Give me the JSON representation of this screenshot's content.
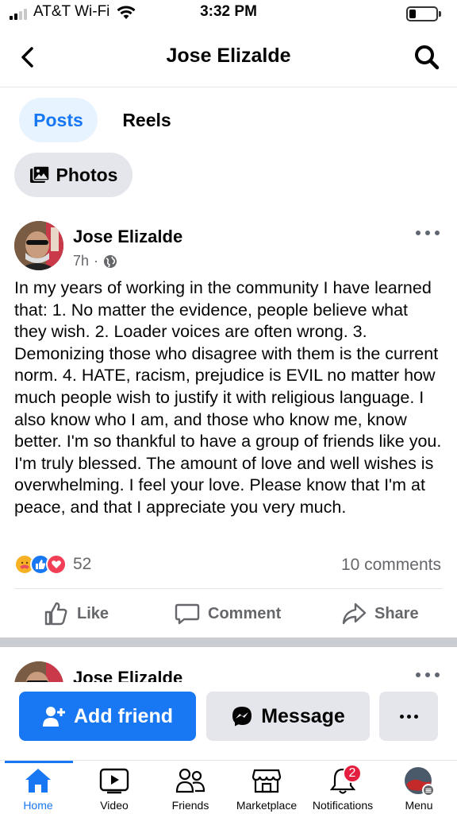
{
  "status_bar": {
    "carrier": "AT&T Wi-Fi",
    "time": "3:32 PM",
    "battery_level": 0.25
  },
  "header": {
    "title": "Jose Elizalde",
    "back_icon": "chevron-left-icon",
    "search_icon": "search-icon"
  },
  "tabs": {
    "posts": "Posts",
    "reels": "Reels",
    "photos": "Photos",
    "active": "Posts"
  },
  "post": {
    "author": "Jose Elizalde",
    "time": "7h",
    "audience": "·",
    "audience_icon": "globe-icon",
    "text": "In my years of working in the community I have learned that: 1. No matter the evidence, people believe what they wish. 2. Loader voices are often wrong. 3. Demonizing those who disagree with them is the current norm. 4. HATE, racism, prejudice is EVIL no matter how much people wish to justify it with religious language. I also know who I am, and those who know me, know better. I'm so thankful to have a group of friends like you. I'm truly blessed. The amount of love and well wishes is overwhelming. I feel your love. Please know that I'm at peace, and that I appreciate you very much.",
    "reaction_count": "52",
    "reaction_icons": [
      "care-icon",
      "like-icon",
      "love-icon"
    ],
    "comments": "10 comments",
    "actions": {
      "like": "Like",
      "comment": "Comment",
      "share": "Share"
    }
  },
  "next_post": {
    "author": "Jose Elizalde"
  },
  "action_bar": {
    "add_friend": "Add friend",
    "message": "Message"
  },
  "tab_bar": {
    "items": [
      {
        "label": "Home",
        "icon": "home-icon",
        "active": true
      },
      {
        "label": "Video",
        "icon": "video-icon"
      },
      {
        "label": "Friends",
        "icon": "friends-icon"
      },
      {
        "label": "Marketplace",
        "icon": "marketplace-icon"
      },
      {
        "label": "Notifications",
        "icon": "bell-icon",
        "badge": "2"
      },
      {
        "label": "Menu",
        "icon": "profile-menu-icon"
      }
    ]
  },
  "colors": {
    "accent": "#1877f2",
    "badge": "#e41e3f",
    "secondary_text": "#65676b"
  }
}
